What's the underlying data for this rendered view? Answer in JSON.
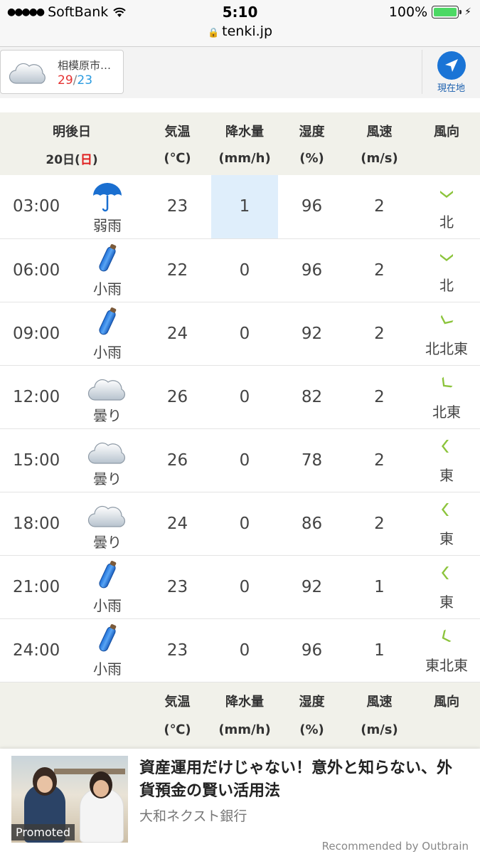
{
  "status_bar": {
    "carrier": "SoftBank",
    "time": "5:10",
    "battery_percent": "100%",
    "url": "tenki.jp"
  },
  "location": {
    "name": "相模原市…",
    "temp_high": "29",
    "temp_sep": "/",
    "temp_low": "23",
    "current_location_label": "現在地",
    "icon": "cloud-icon"
  },
  "table": {
    "day_label": "明後日",
    "date_prefix": "20日(",
    "date_weekday": "日",
    "date_suffix": ")",
    "headers": {
      "temp": "気温",
      "rain": "降水量",
      "humidity": "湿度",
      "wind_speed": "風速",
      "wind_dir": "風向"
    },
    "units": {
      "temp": "(℃)",
      "rain": "(mm/h)",
      "humidity": "(%)",
      "wind_speed": "(m/s)"
    },
    "rows": [
      {
        "time": "03:00",
        "icon": "umbrella-icon",
        "weather": "弱雨",
        "temp": "23",
        "rain": "1",
        "humidity": "96",
        "wind": "2",
        "dir": "北"
      },
      {
        "time": "06:00",
        "icon": "rain-icon",
        "weather": "小雨",
        "temp": "22",
        "rain": "0",
        "humidity": "96",
        "wind": "2",
        "dir": "北"
      },
      {
        "time": "09:00",
        "icon": "rain-icon",
        "weather": "小雨",
        "temp": "24",
        "rain": "0",
        "humidity": "92",
        "wind": "2",
        "dir": "北北東"
      },
      {
        "time": "12:00",
        "icon": "cloud-icon",
        "weather": "曇り",
        "temp": "26",
        "rain": "0",
        "humidity": "82",
        "wind": "2",
        "dir": "北東"
      },
      {
        "time": "15:00",
        "icon": "cloud-icon",
        "weather": "曇り",
        "temp": "26",
        "rain": "0",
        "humidity": "78",
        "wind": "2",
        "dir": "東"
      },
      {
        "time": "18:00",
        "icon": "cloud-icon",
        "weather": "曇り",
        "temp": "24",
        "rain": "0",
        "humidity": "86",
        "wind": "2",
        "dir": "東"
      },
      {
        "time": "21:00",
        "icon": "rain-icon",
        "weather": "小雨",
        "temp": "23",
        "rain": "0",
        "humidity": "92",
        "wind": "1",
        "dir": "東"
      },
      {
        "time": "24:00",
        "icon": "rain-icon",
        "weather": "小雨",
        "temp": "23",
        "rain": "0",
        "humidity": "96",
        "wind": "1",
        "dir": "東北東"
      }
    ]
  },
  "ad": {
    "title": "資産運用だけじゃない！意外と知らない、外貨預金の賢い活用法",
    "sponsor": "大和ネクスト銀行",
    "promoted_label": "Promoted",
    "recommended_by": "Recommended by Outbrain"
  },
  "colors": {
    "high_temp": "#e53333",
    "low_temp": "#2a9be0",
    "rain_highlight": "#dfeefb",
    "wind_arrow": "#8cc43c",
    "header_bg": "#f1f1ea"
  }
}
